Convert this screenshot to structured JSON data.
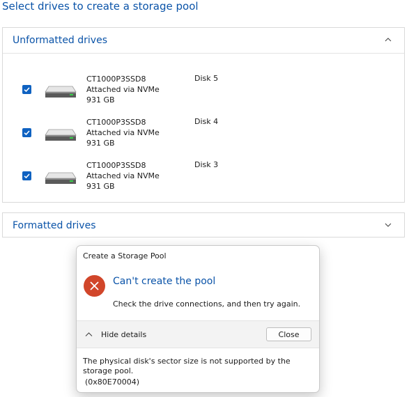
{
  "page": {
    "title": "Select drives to create a storage pool"
  },
  "unformatted": {
    "title": "Unformatted drives",
    "drives": [
      {
        "checked": true,
        "model": "CT1000P3SSD8",
        "connection": "Attached via NVMe",
        "size": "931 GB",
        "disk": "Disk 5"
      },
      {
        "checked": true,
        "model": "CT1000P3SSD8",
        "connection": "Attached via NVMe",
        "size": "931 GB",
        "disk": "Disk 4"
      },
      {
        "checked": true,
        "model": "CT1000P3SSD8",
        "connection": "Attached via NVMe",
        "size": "931 GB",
        "disk": "Disk 3"
      }
    ]
  },
  "formatted": {
    "title": "Formatted drives"
  },
  "dialog": {
    "title": "Create a Storage Pool",
    "heading": "Can't create the pool",
    "message": "Check the drive connections, and then try again.",
    "details_toggle": "Hide details",
    "close_label": "Close",
    "details_text": "The physical disk's sector size is not supported by the storage pool.",
    "error_code": "(0x80E70004)"
  },
  "colors": {
    "accent": "#0a53a8",
    "checkbox": "#0f62c1",
    "error": "#d1462a"
  },
  "icons": {
    "section_expanded": "chevron-up-icon",
    "section_collapsed": "chevron-down-icon",
    "drive": "hard-drive-icon",
    "error": "error-x-icon"
  }
}
